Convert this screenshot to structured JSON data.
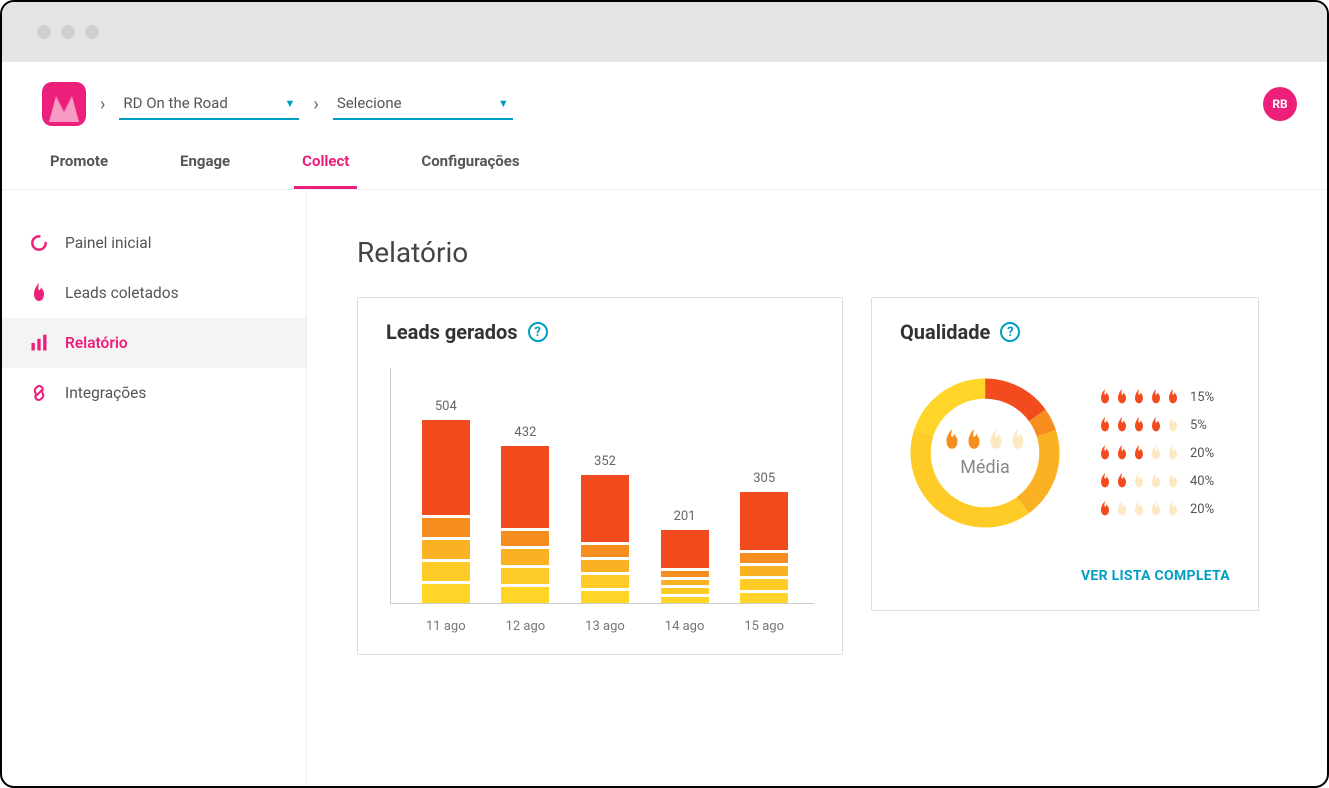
{
  "header": {
    "dropdown1": "RD On the Road",
    "dropdown2": "Selecione",
    "avatar": "RB"
  },
  "tabs": [
    {
      "label": "Promote",
      "active": false
    },
    {
      "label": "Engage",
      "active": false
    },
    {
      "label": "Collect",
      "active": true
    },
    {
      "label": "Configurações",
      "active": false
    }
  ],
  "sidebar": [
    {
      "label": "Painel inicial",
      "icon": "loading",
      "active": false
    },
    {
      "label": "Leads coletados",
      "icon": "flame",
      "active": false
    },
    {
      "label": "Relatório",
      "icon": "bars",
      "active": true
    },
    {
      "label": "Integrações",
      "icon": "link",
      "active": false
    }
  ],
  "page": {
    "title": "Relatório"
  },
  "colors": {
    "c1": "#f14b1e",
    "c2": "#f68d1f",
    "c3": "#fab222",
    "c4": "#fecb27",
    "c5": "#ffd52a",
    "faded": "#fbe9c4"
  },
  "chart_data": {
    "type": "bar",
    "title": "Leads gerados",
    "categories": [
      "11 ago",
      "12 ago",
      "13 ago",
      "14 ago",
      "15 ago"
    ],
    "values": [
      504,
      432,
      352,
      201,
      305
    ],
    "segments": 5,
    "ylim": [
      0,
      550
    ]
  },
  "quality": {
    "title": "Qualidade",
    "center_label": "Média",
    "center_flames_on": 2,
    "center_flames_total": 4,
    "rows": [
      {
        "on": 5,
        "pct": "15%",
        "value": 15
      },
      {
        "on": 4,
        "pct": "5%",
        "value": 5
      },
      {
        "on": 3,
        "pct": "20%",
        "value": 20
      },
      {
        "on": 2,
        "pct": "40%",
        "value": 40
      },
      {
        "on": 1,
        "pct": "20%",
        "value": 20
      }
    ],
    "link": "VER LISTA COMPLETA"
  }
}
